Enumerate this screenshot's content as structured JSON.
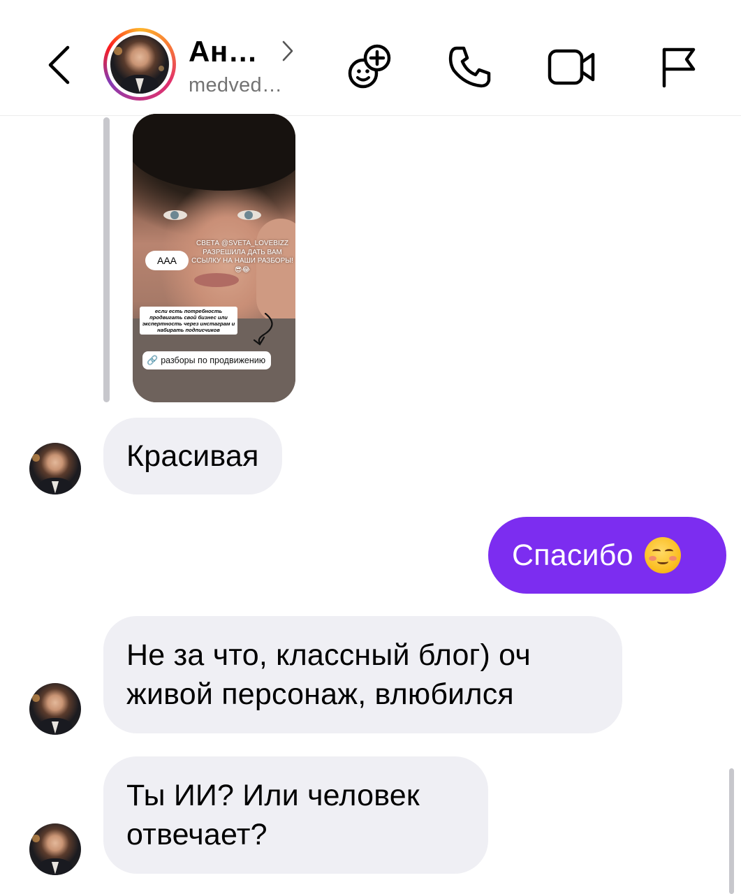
{
  "header": {
    "name": "Ан…",
    "username": "medved…",
    "icons": {
      "back": "chevron-left-icon",
      "profile_chevron": "chevron-right-icon",
      "effects": "smiley-plus-icon",
      "call": "phone-icon",
      "video": "video-camera-icon",
      "report": "flag-icon"
    }
  },
  "story": {
    "sticker": "AAA",
    "overlay_text": "СВЕТА @SVETA_LOVEBIZZ РАЗРЕШИЛА ДАТЬ ВАМ ССЫЛКУ НА НАШИ РАЗБОРЫ!😎😂",
    "note_text": "если есть потребность продвигать свой бизнес или экспертность через инстаграм и набирать подписчиков",
    "link_text": "разборы по продвижению",
    "link_icon": "link-icon"
  },
  "messages": [
    {
      "sender": "them",
      "text": "Красивая"
    },
    {
      "sender": "me",
      "text": "Спасибо",
      "emoji": "smiling-face-icon"
    },
    {
      "sender": "them",
      "text_lines": [
        "Не за что, классный блог) оч",
        "живой персонаж, влюбился"
      ]
    },
    {
      "sender": "them",
      "text_lines": [
        "Ты ИИ? Или человек",
        "отвечает?"
      ]
    }
  ],
  "colors": {
    "outgoing_bubble": "#7c2df0",
    "incoming_bubble": "#efeff4",
    "username": "#737373"
  }
}
